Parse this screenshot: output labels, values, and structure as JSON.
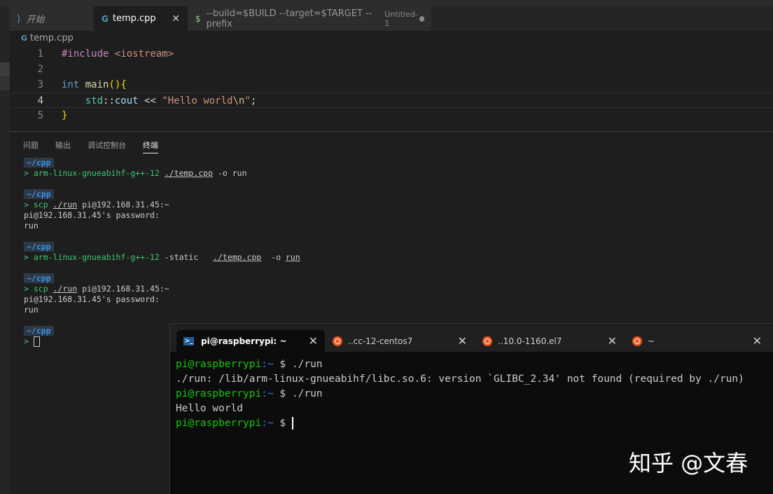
{
  "tabs": [
    {
      "label": "开始",
      "icon": "vscode-icon"
    },
    {
      "label": "temp.cpp",
      "icon": "cpp-file-icon",
      "close": "✕"
    },
    {
      "label": "--build=$BUILD --target=$TARGET --prefix",
      "sub": "Untitled-1",
      "icon": "dollar-icon"
    }
  ],
  "breadcrumb": {
    "file": "temp.cpp"
  },
  "editor": {
    "lines": [
      {
        "n": "1",
        "tokens": [
          [
            "dir",
            "#include"
          ],
          [
            "plain",
            " "
          ],
          [
            "str",
            "<iostream>"
          ]
        ]
      },
      {
        "n": "2",
        "tokens": []
      },
      {
        "n": "3",
        "tokens": [
          [
            "type",
            "int"
          ],
          [
            "plain",
            " "
          ],
          [
            "fn",
            "main"
          ],
          [
            "br",
            "()"
          ],
          [
            "br",
            "{"
          ]
        ]
      },
      {
        "n": "4",
        "tokens": [
          [
            "plain",
            "    "
          ],
          [
            "ns",
            "std"
          ],
          [
            "plain",
            "::"
          ],
          [
            "var",
            "cout"
          ],
          [
            "plain",
            " << "
          ],
          [
            "str",
            "\"Hello world"
          ],
          [
            "esc",
            "\\n"
          ],
          [
            "str",
            "\""
          ],
          [
            "plain",
            ";"
          ]
        ]
      },
      {
        "n": "5",
        "tokens": [
          [
            "br",
            "}"
          ]
        ]
      }
    ]
  },
  "panel": {
    "tabs": [
      "问题",
      "输出",
      "调试控制台",
      "终端"
    ],
    "active": "终端"
  },
  "terminal": {
    "blocks": [
      {
        "dir": "~/cpp",
        "cmd": [
          [
            "green",
            "> arm-linux-gnueabihf-g++-12 "
          ],
          [
            "ul",
            "./temp.cpp"
          ],
          [
            "plain",
            " -o run"
          ]
        ],
        "output": []
      },
      {
        "dir": "~/cpp",
        "cmd": [
          [
            "green",
            "> scp "
          ],
          [
            "ul",
            "./run"
          ],
          [
            "plain",
            " pi@192.168.31.45:~"
          ]
        ],
        "output": [
          "pi@192.168.31.45's password:",
          "run"
        ]
      },
      {
        "dir": "~/cpp",
        "cmd": [
          [
            "green",
            "> arm-linux-gnueabihf-g++-12 "
          ],
          [
            "plain",
            "-static   "
          ],
          [
            "ul",
            "./temp.cpp"
          ],
          [
            "plain",
            "  -o "
          ],
          [
            "ul",
            "run"
          ]
        ],
        "output": []
      },
      {
        "dir": "~/cpp",
        "cmd": [
          [
            "green",
            "> scp "
          ],
          [
            "ul",
            "./run"
          ],
          [
            "plain",
            " pi@192.168.31.45:~"
          ]
        ],
        "output": [
          "pi@192.168.31.45's password:",
          "run"
        ]
      },
      {
        "dir": "~/cpp",
        "cmd": [
          [
            "green",
            "> "
          ]
        ],
        "output": []
      }
    ]
  },
  "wt": {
    "tabs": [
      {
        "label": "pi@raspberrypi: ~",
        "icon": "powershell-icon",
        "close": "✕"
      },
      {
        "label": "..cc-12-centos7",
        "icon": "ubuntu-icon",
        "close": "✕"
      },
      {
        "label": "..10.0-1160.el7",
        "icon": "ubuntu-icon",
        "close": "✕"
      },
      {
        "label": "~",
        "icon": "ubuntu-icon",
        "close": "✕"
      }
    ],
    "prompt_user": "pi@raspberrypi",
    "prompt_path": ":~",
    "prompt_sign": " $",
    "lines": [
      {
        "type": "prompt",
        "cmd": " ./run"
      },
      {
        "type": "out",
        "text": "./run: /lib/arm-linux-gnueabihf/libc.so.6: version `GLIBC_2.34' not found (required by ./run)"
      },
      {
        "type": "prompt",
        "cmd": " ./run"
      },
      {
        "type": "out",
        "text": "Hello world"
      },
      {
        "type": "prompt",
        "cmd": " "
      }
    ]
  },
  "watermark": "知乎 @文春"
}
